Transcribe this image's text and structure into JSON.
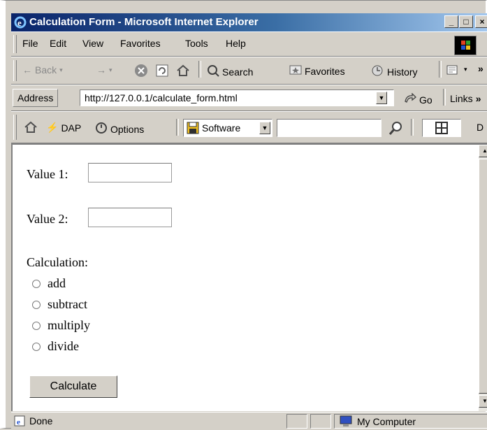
{
  "window": {
    "title": "Calculation Form - Microsoft Internet Explorer",
    "controls": [
      "_",
      "□",
      "×"
    ]
  },
  "menu": {
    "items": [
      "File",
      "Edit",
      "View",
      "Favorites",
      "Tools",
      "Help"
    ]
  },
  "toolbar": {
    "back_label": "Back",
    "search_label": "Search",
    "favorites_label": "Favorites",
    "history_label": "History"
  },
  "address_bar": {
    "label": "Address",
    "url": "http://127.0.0.1/calculate_form.html",
    "go_label": "Go",
    "links_label": "Links"
  },
  "extra_toolbar": {
    "dap_label": "DAP",
    "options_label": "Options",
    "software_label": "Software",
    "search_value": "",
    "trailing_label": "D"
  },
  "form": {
    "value1_label": "Value 1:",
    "value1_value": "",
    "value2_label": "Value 2:",
    "value2_value": "",
    "calculation_label": "Calculation:",
    "options": [
      "add",
      "subtract",
      "multiply",
      "divide"
    ],
    "submit_label": "Calculate"
  },
  "status_bar": {
    "status_text": "Done",
    "zone_text": "My Computer"
  },
  "colors": {
    "title_bar_start": "#0a246a",
    "title_bar_end": "#a6caf0",
    "chrome": "#d4d0c8"
  }
}
